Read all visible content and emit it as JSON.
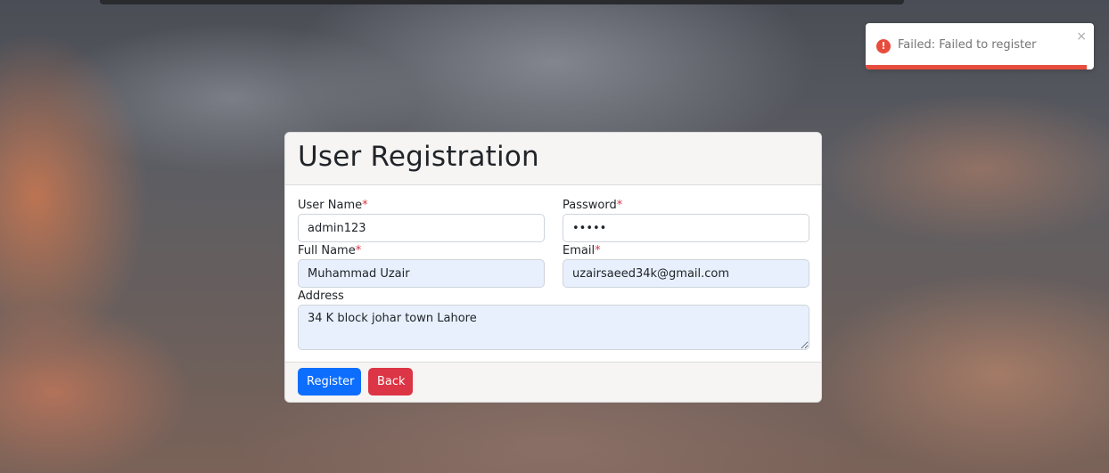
{
  "form": {
    "title": "User Registration",
    "fields": {
      "username": {
        "label": "User Name",
        "required_mark": "*",
        "value": "admin123"
      },
      "password": {
        "label": "Password",
        "required_mark": "*",
        "value": "•••••"
      },
      "fullname": {
        "label": "Full Name",
        "required_mark": "*",
        "value": "Muhammad Uzair"
      },
      "email": {
        "label": "Email",
        "required_mark": "*",
        "value": "uzairsaeed34k@gmail.com"
      },
      "address": {
        "label": "Address",
        "value": "34 K block johar town Lahore"
      }
    },
    "buttons": {
      "register": "Register",
      "back": "Back"
    }
  },
  "toast": {
    "icon": "error-icon",
    "icon_glyph": "!",
    "message": "Failed: Failed to register",
    "close_glyph": "×",
    "progress": 0.97,
    "color": "#e74c3c"
  },
  "colors": {
    "primary": "#0d6efd",
    "danger": "#dc3545",
    "required": "#dc3545",
    "autofill": "#e8f0fe"
  }
}
